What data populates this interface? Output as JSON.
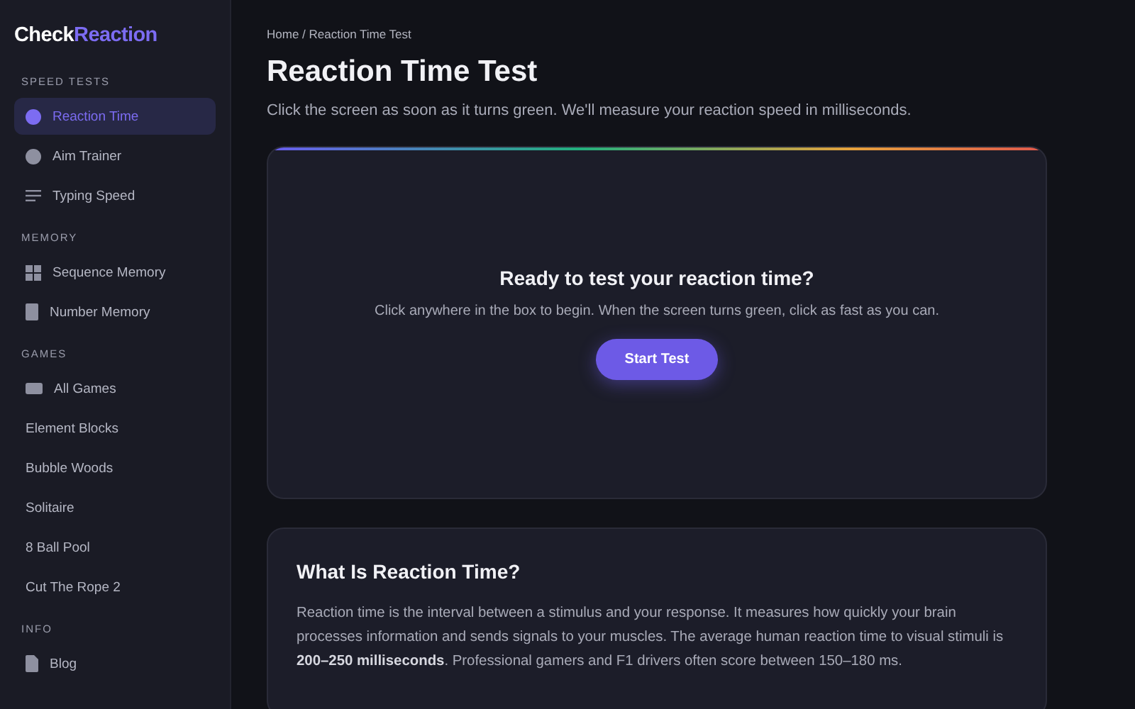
{
  "logo": {
    "part_1": "Check",
    "part_2": "Reaction"
  },
  "sidebar": {
    "sections": [
      {
        "label": "SPEED TESTS",
        "items": [
          {
            "label": "Reaction Time",
            "kind": "dot",
            "selected": true
          },
          {
            "label": "Aim Trainer",
            "kind": "dot",
            "selected": false
          },
          {
            "label": "Typing Speed",
            "kind": "lines",
            "selected": false
          }
        ]
      },
      {
        "label": "MEMORY",
        "items": [
          {
            "label": "Sequence Memory",
            "kind": "grid",
            "selected": false
          },
          {
            "label": "Number Memory",
            "kind": "tablet",
            "selected": false
          }
        ]
      },
      {
        "label": "GAMES",
        "items": [
          {
            "label": "All Games",
            "kind": "gamepad",
            "selected": false
          },
          {
            "label": "Element Blocks",
            "kind": "plain",
            "selected": false
          },
          {
            "label": "Bubble Woods",
            "kind": "plain",
            "selected": false
          },
          {
            "label": "Solitaire",
            "kind": "plain",
            "selected": false
          },
          {
            "label": "8 Ball Pool",
            "kind": "plain",
            "selected": false
          },
          {
            "label": "Cut The Rope 2",
            "kind": "plain",
            "selected": false
          }
        ]
      },
      {
        "label": "INFO",
        "items": [
          {
            "label": "Blog",
            "kind": "file",
            "selected": false
          }
        ]
      }
    ]
  },
  "breadcrumb": "Home / Reaction Time Test",
  "title": "Reaction Time Test",
  "subtitle": "Click the screen as soon as it turns green. We'll measure your reaction speed in milliseconds.",
  "test_box": {
    "heading": "Ready to test your reaction time?",
    "text": "Click anywhere in the box to begin. When the screen turns green, click as fast as you can.",
    "button": "Start Test"
  },
  "info_card": {
    "heading": "What Is Reaction Time?",
    "text": "Reaction time is the interval between a stimulus and your response. It measures how quickly your brain processes information and sends signals to your muscles. The average human reaction time to visual stimuli is **200–250 milliseconds**. Professional gamers and F1 drivers often score between 150–180 ms."
  }
}
